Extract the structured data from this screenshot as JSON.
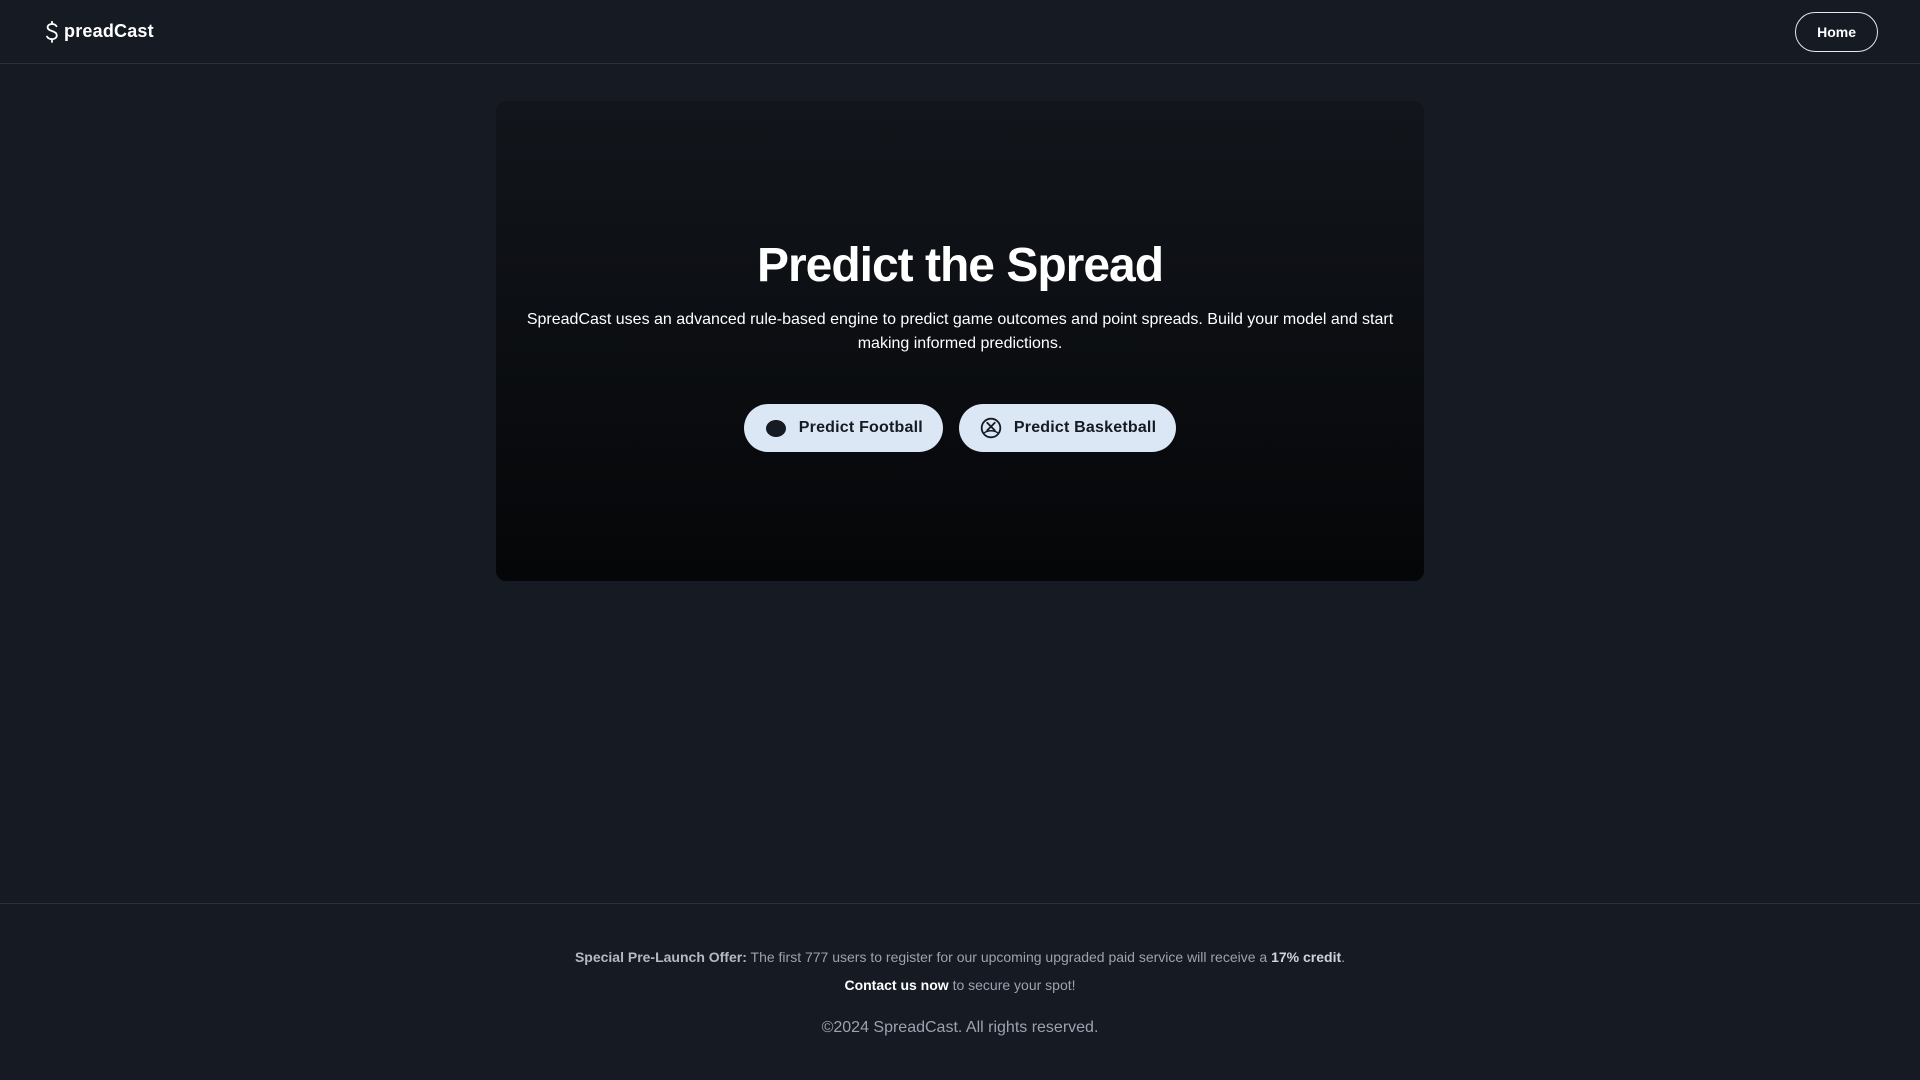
{
  "header": {
    "brand_name": "preadCast",
    "brand_icon": "dollar-s-icon",
    "home_label": "Home"
  },
  "hero": {
    "title": "Predict the Spread",
    "description": "SpreadCast uses an advanced rule-based engine to predict game outcomes and point spreads. Build your model and start making informed predictions.",
    "buttons": [
      {
        "label": "Predict Football",
        "icon": "football-icon"
      },
      {
        "label": "Predict Basketball",
        "icon": "basketball-icon"
      }
    ]
  },
  "footer": {
    "offer_label": "Special Pre-Launch Offer:",
    "offer_text_before": " The first 777 users to register for our upcoming upgraded paid service will receive a ",
    "offer_credit": "17% credit",
    "offer_text_after": ".",
    "contact_link": "Contact us now",
    "contact_text": " to secure your spot!",
    "copyright": "©2024 SpreadCast. All rights reserved."
  },
  "colors": {
    "background": "#151a23",
    "button_bg": "#dbe7f5",
    "button_text": "#151a23",
    "muted_text": "#9ca3af"
  }
}
